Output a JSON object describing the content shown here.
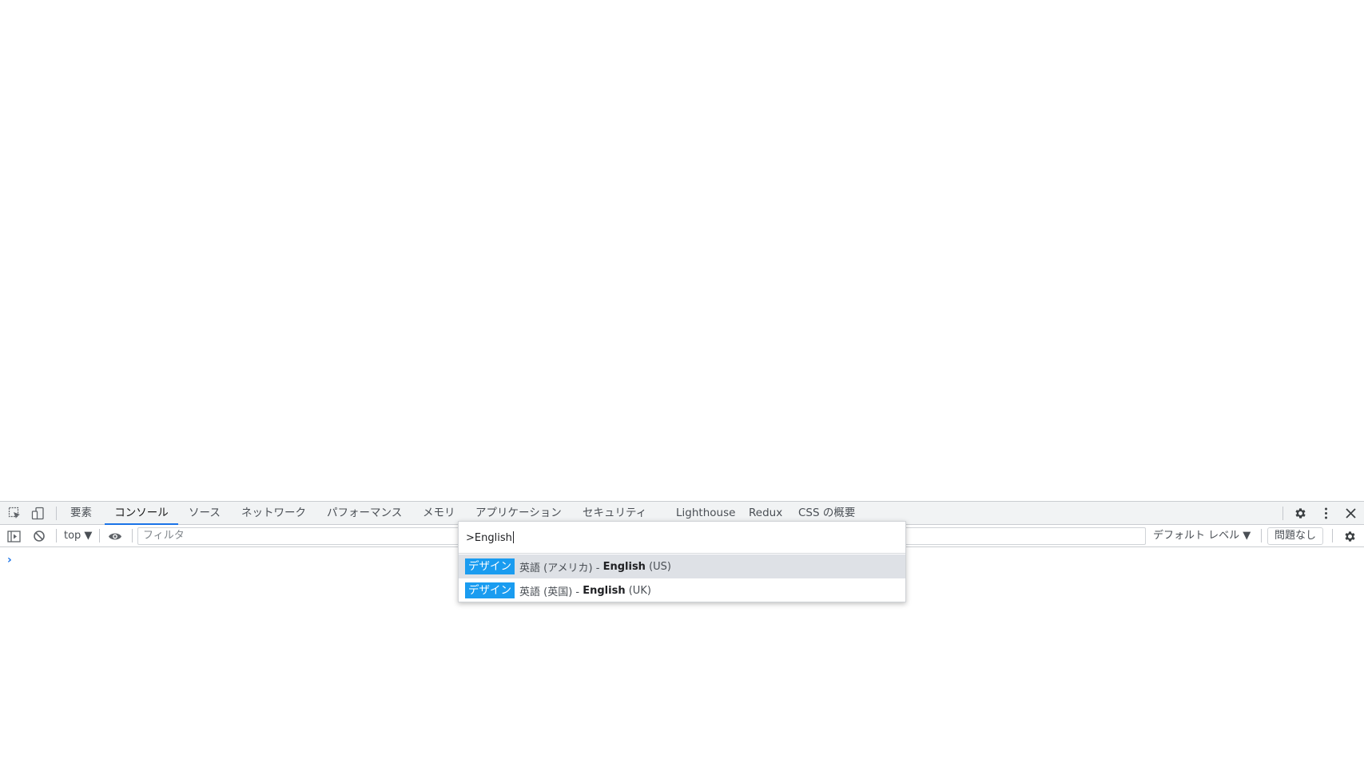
{
  "devtools": {
    "tabs": [
      {
        "label": "要素",
        "active": false
      },
      {
        "label": "コンソール",
        "active": true
      },
      {
        "label": "ソース",
        "active": false
      },
      {
        "label": "ネットワーク",
        "active": false
      },
      {
        "label": "パフォーマンス",
        "active": false
      },
      {
        "label": "メモリ",
        "active": false
      },
      {
        "label": "アプリケーション",
        "active": false
      },
      {
        "label": "セキュリティ",
        "active": false
      },
      {
        "label": "Lighthouse",
        "active": false
      },
      {
        "label": "Redux",
        "active": false
      },
      {
        "label": "CSS の概要",
        "active": false
      }
    ],
    "toolbar": {
      "context": "top ▼",
      "filter_placeholder": "フィルタ",
      "level": "デフォルト レベル ▼",
      "issues": "問題なし"
    },
    "prompt": "›"
  },
  "command_menu": {
    "query_prefix": ">",
    "query": "English",
    "items": [
      {
        "category": "デザイン",
        "pre": "英語 (アメリカ) - ",
        "match": "English",
        "post": " (US)",
        "selected": true
      },
      {
        "category": "デザイン",
        "pre": "英語 (英国) - ",
        "match": "English",
        "post": " (UK)",
        "selected": false
      }
    ]
  },
  "colors": {
    "accent": "#1a73e8",
    "badge": "#1a9cf0",
    "selected_row": "#dee1e6"
  }
}
